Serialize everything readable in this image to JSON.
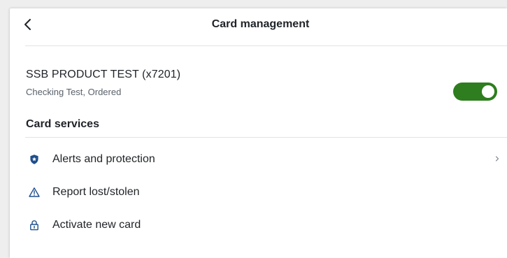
{
  "header": {
    "title": "Card management",
    "back_icon": "chevron-left-icon"
  },
  "card": {
    "name": "SSB PRODUCT TEST (x7201)",
    "subtitle": "Checking Test, Ordered",
    "toggle_on": true,
    "toggle_color": "#2e7d1e"
  },
  "services": {
    "title": "Card services",
    "items": [
      {
        "label": "Alerts and protection",
        "icon": "shield-icon",
        "has_chevron": true
      },
      {
        "label": "Report lost/stolen",
        "icon": "warning-icon",
        "has_chevron": false
      },
      {
        "label": "Activate new card",
        "icon": "lock-icon",
        "has_chevron": false
      }
    ]
  },
  "colors": {
    "icon_blue": "#1f4e8c",
    "divider": "#e1e3e6",
    "background": "#eeeeee"
  }
}
